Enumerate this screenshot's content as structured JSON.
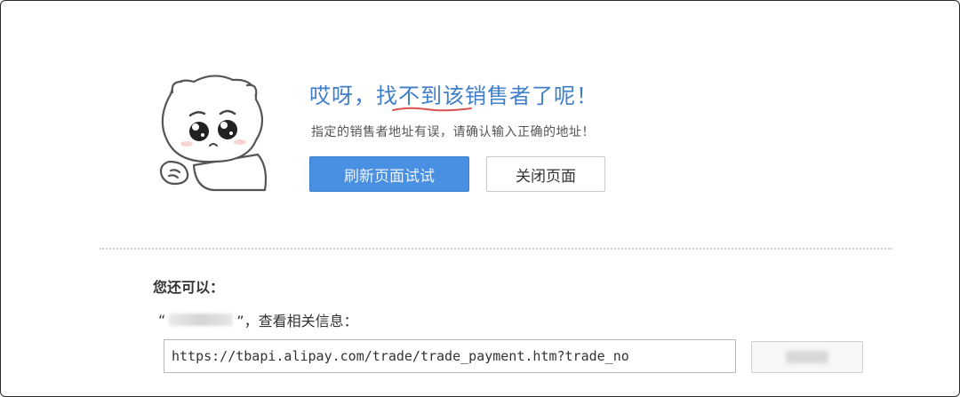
{
  "error": {
    "title_before": "哎呀，",
    "title_highlight": "找不到",
    "title_after": "该销售者了呢！",
    "subtitle": "指定的销售者地址有误，请确认输入正确的地址！"
  },
  "buttons": {
    "refresh_label": "刷新页面试试",
    "close_label": "关闭页面"
  },
  "more": {
    "heading": "您还可以：",
    "info_prefix": "“",
    "info_suffix": "”，查看相关信息：",
    "url_value": "https://tbapi.alipay.com/trade/trade_payment.htm?trade_no"
  },
  "colors": {
    "accent_blue": "#4a90e2",
    "title_blue": "#3f7ec9",
    "underline_red": "#d9534f"
  }
}
